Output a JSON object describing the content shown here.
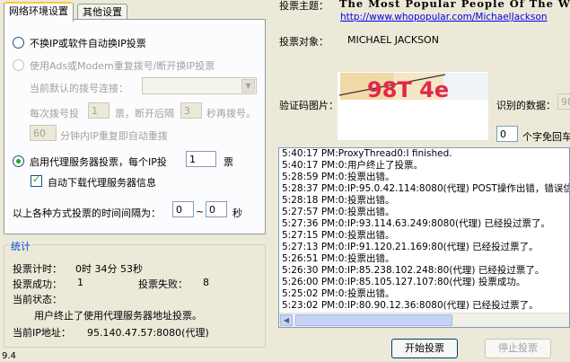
{
  "tabs": [
    {
      "label": "网络环境设置"
    },
    {
      "label": "其他设置"
    }
  ],
  "network": {
    "option_no_ip_change": "不换IP或软件自动换IP投票",
    "option_adsl": "使用Ads或Modem重复拨号/断开换IP投票",
    "default_dial_label": "当前默认的拨号连接：",
    "dial_each": "每次拨号投",
    "dial_each_value": "1",
    "dial_each_unit": "票，断开后隔",
    "dial_wait_value": "3",
    "dial_wait_unit": "秒再拨号。",
    "redial_value": "60",
    "redial_text": "分钟内IP重复即自动重拨",
    "option_proxy": "启用代理服务器投票，每个IP投",
    "proxy_votes_value": "1",
    "proxy_votes_unit": "票",
    "auto_download_proxy": "自动下载代理服务器信息",
    "interval_label": "以上各种方式投票的时间间隔为：",
    "interval_from": "0",
    "interval_sep": "~",
    "interval_to": "0",
    "interval_unit": "秒"
  },
  "stats": {
    "title": "统计",
    "timer_label": "投票计时：",
    "timer_value": "0时 34分 53秒",
    "success_label": "投票成功：",
    "success_value": "1",
    "fail_label": "投票失败：",
    "fail_value": "8",
    "status_label": "当前状态：",
    "status_value": "用户终止了使用代理服务器地址投票。",
    "ip_label": "当前IP地址：",
    "ip_value": "95.140.47.57:8080(代理)"
  },
  "vote": {
    "topic_label": "投票主题：",
    "topic_value": "The Most Popular People Of The W",
    "topic_url": "http://www.whopopular.com/MichaelJackson",
    "target_label": "投票对象：",
    "target_value": "MICHAEL JACKSON",
    "captcha_label": "验证码图片：",
    "captcha_text": "98T 4e",
    "recognized_label": "识别的数据：",
    "recognized_value": "98",
    "retry_value": "0",
    "retry_text": "个字免回车"
  },
  "log": [
    "5:40:17 PM:ProxyThread0:I finished.",
    "5:40:17 PM:0:用户终止了投票。",
    "5:28:59 PM:0:投票出错。",
    "5:28:37 PM:0:IP:95.0.42.114:8080(代理) POST操作出错，错误信",
    "5:28:18 PM:0:投票出错。",
    "5:27:57 PM:0:投票出错。",
    "5:27:36 PM:0:IP:93.114.63.249:8080(代理) 已经投过票了。",
    "5:27:15 PM:0:投票出错。",
    "5:27:13 PM:0:IP:91.120.21.169:80(代理) 已经投过票了。",
    "5:26:51 PM:0:投票出错。",
    "5:26:30 PM:0:IP:85.238.102.248:80(代理) 已经投过票了。",
    "5:26:00 PM:0:IP:85.105.127.107:80(代理) 投票成功。",
    "5:25:02 PM:0:投票出错。",
    "5:23:02 PM:0:IP:80.90.12.36:8080(代理) 已经投过票了。"
  ],
  "buttons": {
    "start": "开始投票",
    "stop": "停止投票"
  },
  "version": "9.4",
  "colors": {
    "link": "#0000ee",
    "groupTitle": "#0046d5",
    "radioDot": "#21a121"
  }
}
